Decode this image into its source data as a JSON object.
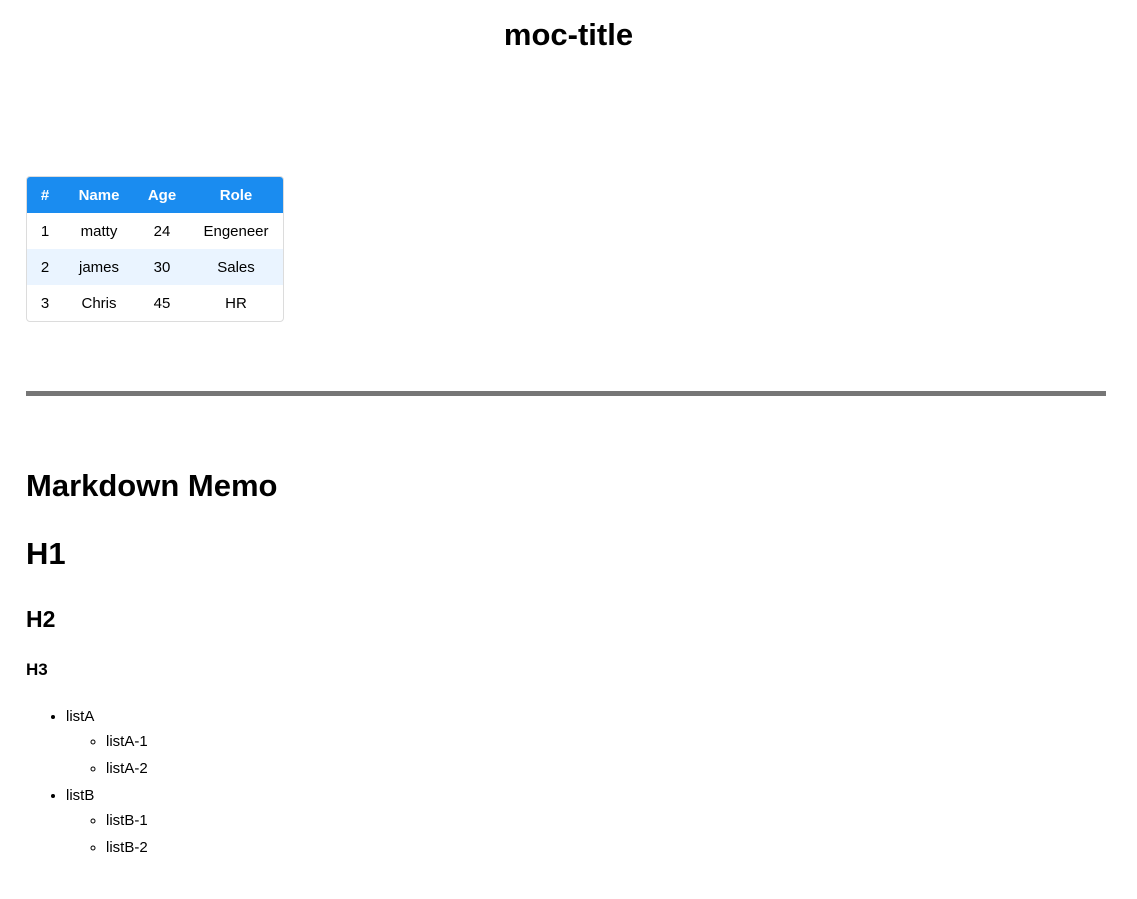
{
  "title": "moc-title",
  "table": {
    "headers": [
      "#",
      "Name",
      "Age",
      "Role"
    ],
    "rows": [
      [
        "1",
        "matty",
        "24",
        "Engeneer"
      ],
      [
        "2",
        "james",
        "30",
        "Sales"
      ],
      [
        "3",
        "Chris",
        "45",
        "HR"
      ]
    ],
    "header_color": "#1a8cf0",
    "alt_row_color": "#eaf4ff"
  },
  "memo": {
    "title": "Markdown Memo",
    "h1": "H1",
    "h2": "H2",
    "h3": "H3",
    "list": [
      {
        "label": "listA",
        "children": [
          "listA-1",
          "listA-2"
        ]
      },
      {
        "label": "listB",
        "children": [
          "listB-1",
          "listB-2"
        ]
      }
    ]
  },
  "divider_color": "#767676"
}
